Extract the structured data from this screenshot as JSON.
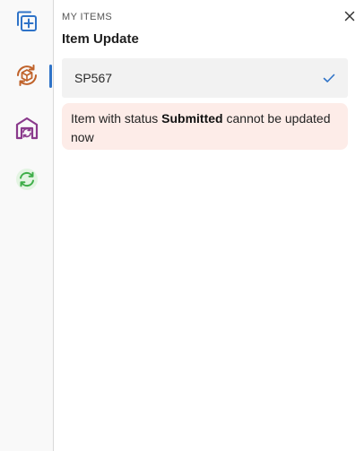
{
  "header": {
    "section_label": "MY ITEMS",
    "title": "Item Update"
  },
  "sidebar": {
    "items": [
      {
        "name": "add-copy",
        "icon": "add-copy-icon",
        "color": "#2f73c8"
      },
      {
        "name": "package-refresh",
        "icon": "package-refresh-icon",
        "color": "#c0622a",
        "active": true
      },
      {
        "name": "warehouse-refresh",
        "icon": "warehouse-refresh-icon",
        "color": "#8a3a8c"
      },
      {
        "name": "sync",
        "icon": "sync-icon",
        "color": "#3fae49"
      }
    ],
    "active_indicator_color": "#2f73c8"
  },
  "item_select": {
    "value": "SP567",
    "check_color": "#2f73c8"
  },
  "alert": {
    "prefix": "Item with status ",
    "status": "Submitted",
    "suffix": " cannot be updated now",
    "background": "#fdece8"
  }
}
